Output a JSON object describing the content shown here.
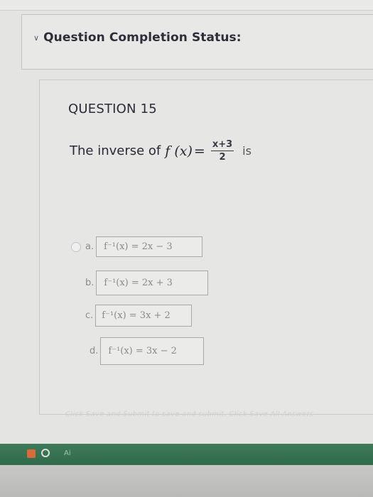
{
  "status": {
    "chevron": "chevron-down-icon",
    "title": "Question Completion Status:"
  },
  "question": {
    "number": "QUESTION 15",
    "prompt_prefix": "The inverse of",
    "function": "f (x)",
    "equals": "=",
    "numerator": "x+3",
    "denominator": "2",
    "suffix": "is"
  },
  "options": [
    {
      "letter": "a.",
      "answer": "f⁻¹(x) = 2x − 3"
    },
    {
      "letter": "b.",
      "answer": "f⁻¹(x) = 2x + 3"
    },
    {
      "letter": "c.",
      "answer": "f⁻¹(x) = 3x + 2"
    },
    {
      "letter": "d.",
      "answer": "f⁻¹(x) = 3x − 2"
    }
  ],
  "footer": {
    "instruction": "Click Save and Submit to save and submit. Click Save All Answers"
  },
  "taskbar": {
    "label": "Ai"
  },
  "colors": {
    "screen_bg": "#e4e4e2",
    "title_text": "#2e2e3a",
    "taskbar": "#3f7a5a"
  }
}
